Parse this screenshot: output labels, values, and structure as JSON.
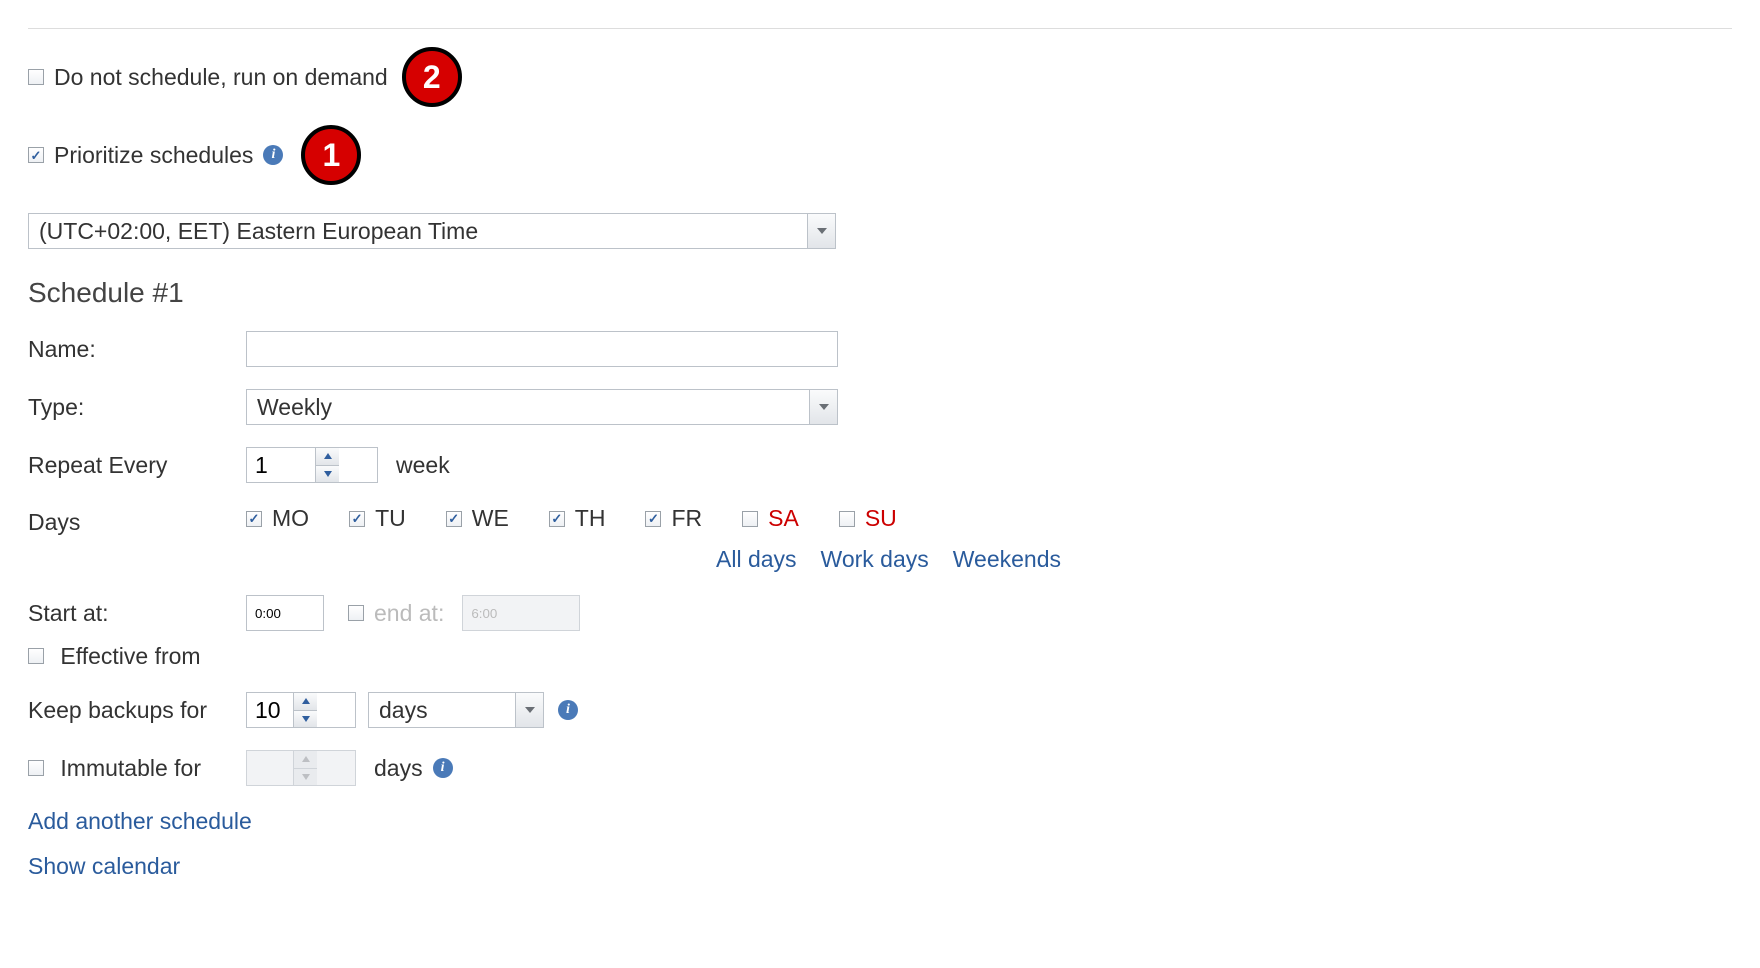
{
  "top": {
    "do_not_schedule_label": "Do not schedule, run on demand",
    "do_not_schedule_checked": false,
    "prioritize_label": "Prioritize schedules",
    "prioritize_checked": true,
    "timezone": "(UTC+02:00, EET) Eastern European Time",
    "badge1": "1",
    "badge2": "2"
  },
  "schedule": {
    "title": "Schedule #1",
    "name_label": "Name:",
    "name_value": "",
    "type_label": "Type:",
    "type_value": "Weekly",
    "repeat_label": "Repeat Every",
    "repeat_value": "1",
    "repeat_unit": "week",
    "days_label": "Days",
    "days": [
      {
        "code": "MO",
        "checked": true,
        "weekend": false
      },
      {
        "code": "TU",
        "checked": true,
        "weekend": false
      },
      {
        "code": "WE",
        "checked": true,
        "weekend": false
      },
      {
        "code": "TH",
        "checked": true,
        "weekend": false
      },
      {
        "code": "FR",
        "checked": true,
        "weekend": false
      },
      {
        "code": "SA",
        "checked": false,
        "weekend": true
      },
      {
        "code": "SU",
        "checked": false,
        "weekend": true
      }
    ],
    "quick": {
      "all": "All days",
      "work": "Work days",
      "weekends": "Weekends"
    },
    "start_label": "Start at:",
    "start_value": "0:00",
    "end_enabled": false,
    "end_label": "end at:",
    "end_value": "6:00",
    "effective_label": "Effective from",
    "effective_checked": false,
    "keep_label": "Keep backups for",
    "keep_value": "10",
    "keep_unit": "days",
    "immutable_label": "Immutable for",
    "immutable_checked": false,
    "immutable_value": "",
    "immutable_unit": "days",
    "add_link": "Add another schedule",
    "show_calendar": "Show calendar"
  }
}
